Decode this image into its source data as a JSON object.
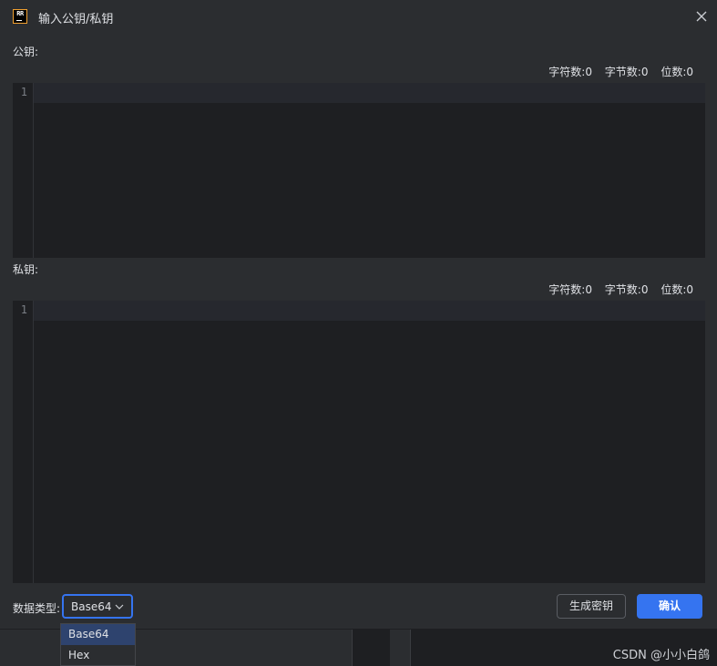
{
  "window": {
    "title": "输入公钥/私钥",
    "logo_text": "RR"
  },
  "public_key": {
    "label": "公钥:",
    "stats": {
      "chars": "字符数:0",
      "bytes": "字节数:0",
      "bits": "位数:0"
    },
    "line_number": "1"
  },
  "private_key": {
    "label": "私钥:",
    "stats": {
      "chars": "字符数:0",
      "bytes": "字节数:0",
      "bits": "位数:0"
    },
    "line_number": "1"
  },
  "footer": {
    "data_type_label": "数据类型:",
    "data_type_selected": "Base64",
    "options": [
      "Base64",
      "Hex"
    ],
    "generate_label": "生成密钥",
    "confirm_label": "确认"
  },
  "watermark": "CSDN @小小白鸽",
  "colors": {
    "accent": "#3574f0",
    "background": "#2b2d30",
    "editor": "#1e1f22"
  }
}
